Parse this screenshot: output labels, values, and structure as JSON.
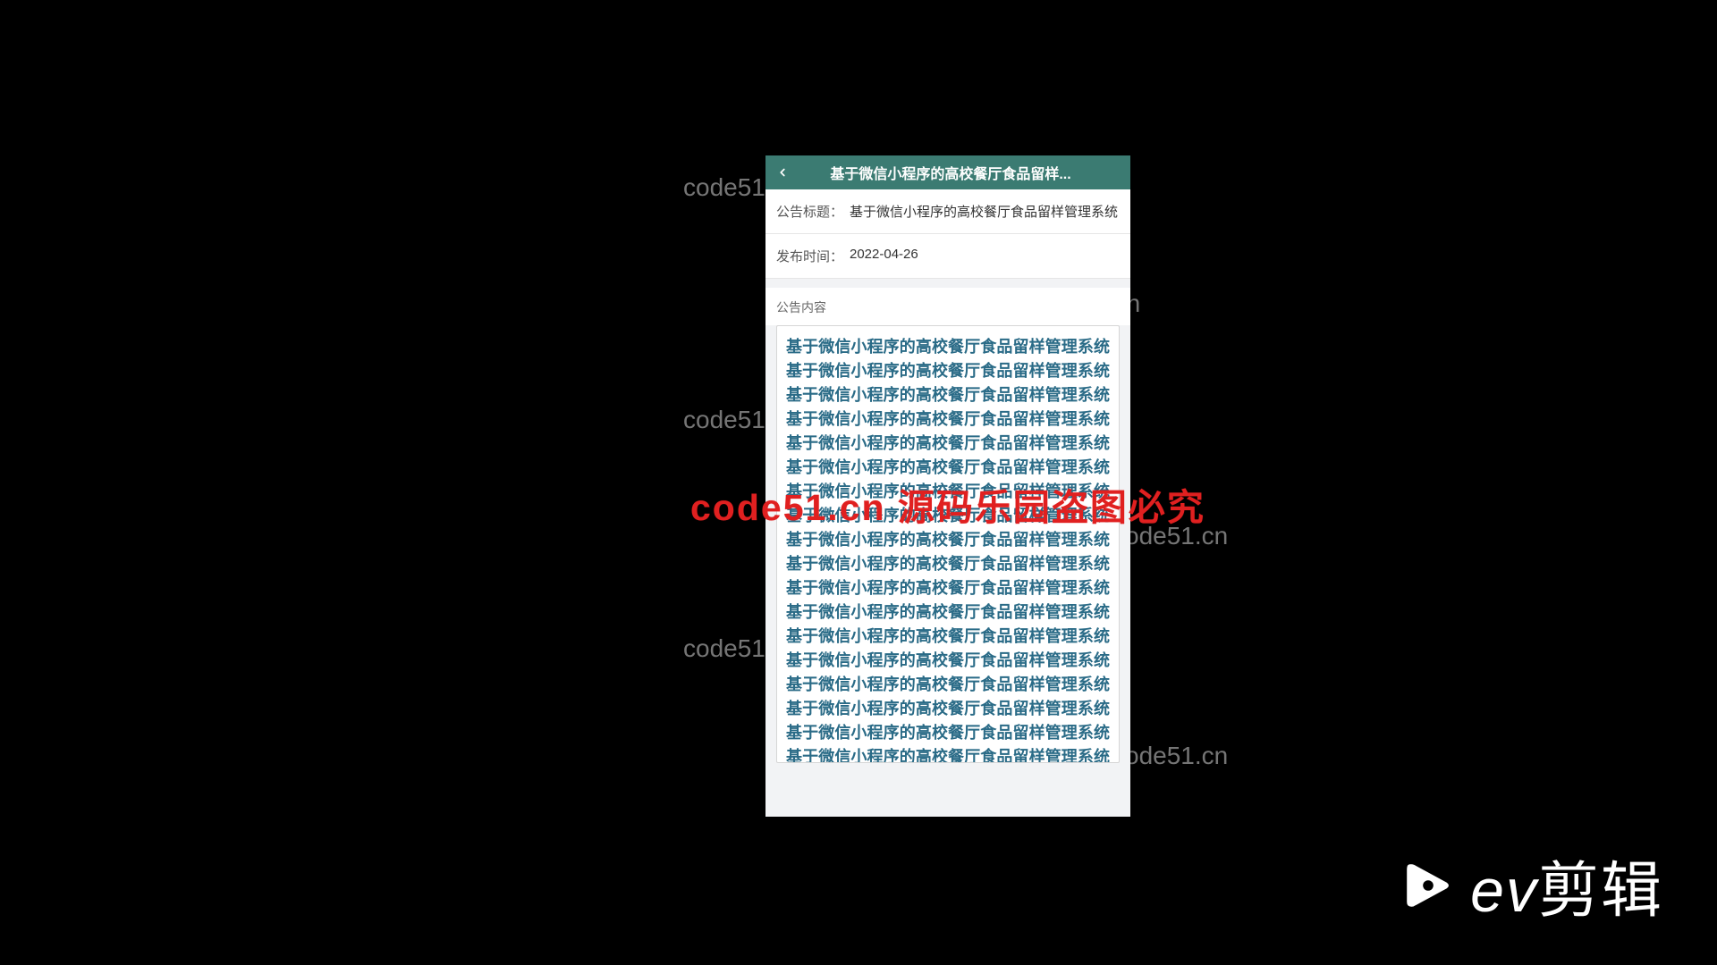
{
  "header": {
    "title": "基于微信小程序的高校餐厅食品留样..."
  },
  "info": {
    "title_label": "公告标题：",
    "title_value": "基于微信小程序的高校餐厅食品留样管理系统",
    "time_label": "发布时间：",
    "time_value": "2022-04-26"
  },
  "content": {
    "section_label": "公告内容",
    "body": "基于微信小程序的高校餐厅食品留样管理系统基于微信小程序的高校餐厅食品留样管理系统基于微信小程序的高校餐厅食品留样管理系统基于微信小程序的高校餐厅食品留样管理系统基于微信小程序的高校餐厅食品留样管理系统基于微信小程序的高校餐厅食品留样管理系统基于微信小程序的高校餐厅食品留样管理系统基于微信小程序的高校餐厅食品留样管理系统基于微信小程序的高校餐厅食品留样管理系统基于微信小程序的高校餐厅食品留样管理系统基于微信小程序的高校餐厅食品留样管理系统基于微信小程序的高校餐厅食品留样管理系统基于微信小程序的高校餐厅食品留样管理系统基于微信小程序的高校餐厅食品留样管理系统基于微信小程序的高校餐厅食品留样管理系统基于微信小程序的高校餐厅食品留样管理系统基于微信小程序的高校餐厅食品留样管理系统基于微信小程序的高校餐厅食品留样管理系统基于微信"
  },
  "watermarks": {
    "grey": "code51.cn",
    "red": "code51.cn 源码乐园盗图必究"
  },
  "branding": {
    "ev_cn": "剪辑"
  }
}
